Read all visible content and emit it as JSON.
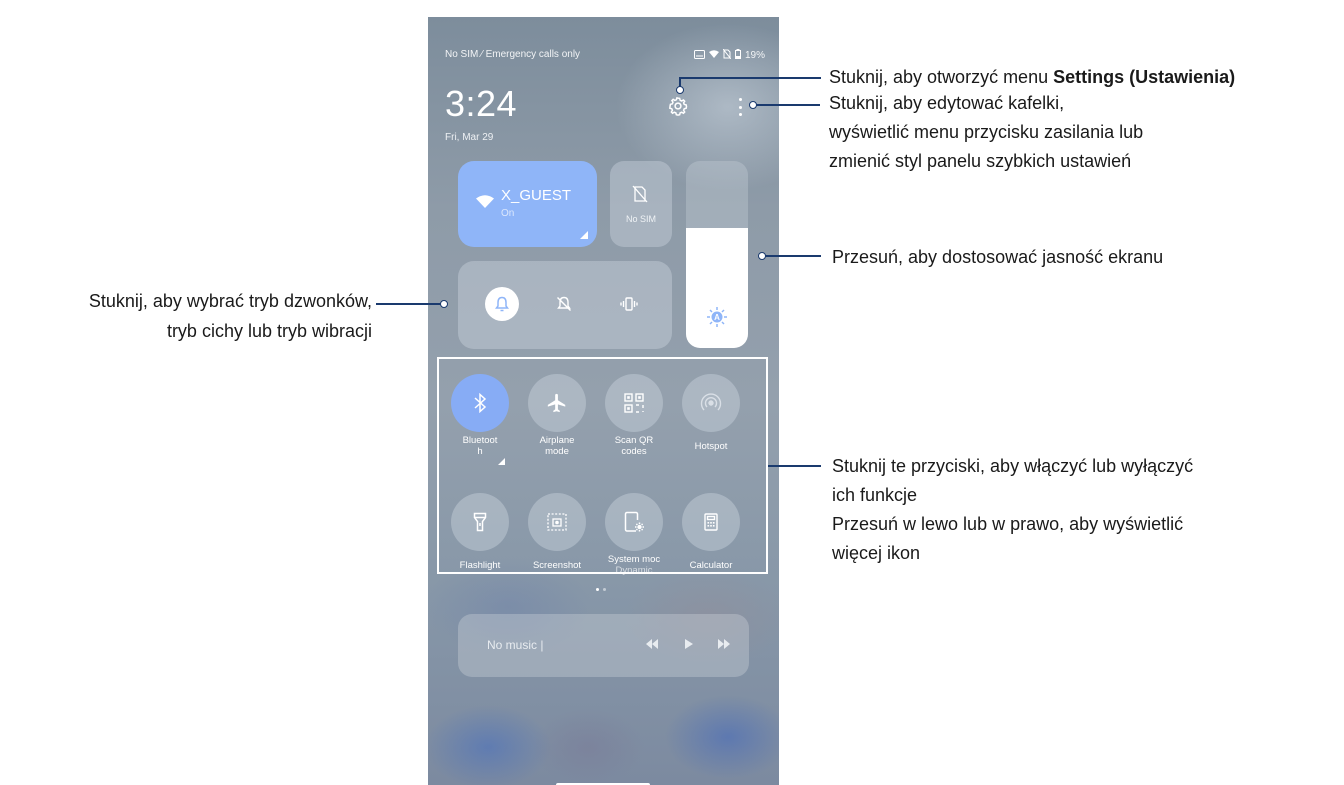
{
  "status_bar": {
    "carrier": "No SIM ⁄ Emergency calls only",
    "battery": "19%"
  },
  "header": {
    "time": "3:24",
    "date": "Fri, Mar 29"
  },
  "tiles": {
    "wifi": {
      "name": "X_GUEST",
      "status": "On"
    },
    "sim": {
      "label": "No SIM"
    },
    "brightness_level": 0.64
  },
  "quick_settings": [
    {
      "label": "Bluetoot\nh",
      "sublabel": "",
      "icon": "bluetooth-icon",
      "on": true
    },
    {
      "label": "Airplane\nmode",
      "sublabel": "",
      "icon": "airplane-icon",
      "on": false
    },
    {
      "label": "Scan QR\ncodes",
      "sublabel": "",
      "icon": "qr-icon",
      "on": false
    },
    {
      "label": "Hotspot",
      "sublabel": "",
      "icon": "hotspot-icon",
      "on": false
    },
    {
      "label": "Flashlight",
      "sublabel": "",
      "icon": "flashlight-icon",
      "on": false
    },
    {
      "label": "Screenshot",
      "sublabel": "",
      "icon": "screenshot-icon",
      "on": false
    },
    {
      "label": "System moc",
      "sublabel": "Dynamic",
      "icon": "system-mode-icon",
      "on": false
    },
    {
      "label": "Calculator",
      "sublabel": "",
      "icon": "calculator-icon",
      "on": false
    }
  ],
  "media": {
    "text": "No music |"
  },
  "annotations": {
    "settings_prefix": "Stuknij, aby otworzyć menu ",
    "settings_bold": "Settings (Ustawienia)",
    "edit_line1": "Stuknij, aby edytować kafelki,",
    "edit_line2": "wyświetlić menu przycisku zasilania lub",
    "edit_line3": "zmienić styl panelu szybkich ustawień",
    "brightness": "Przesuń, aby dostosować jasność ekranu",
    "ring_line1": "Stuknij, aby wybrać tryb dzwonków,",
    "ring_line2": "tryb cichy lub tryb wibracji",
    "toggle_line1": "Stuknij te przyciski, aby włączyć lub wyłączyć",
    "toggle_line2": "ich funkcje",
    "toggle_line3": "Przesuń w lewo lub w prawo, aby wyświetlić",
    "toggle_line4": "więcej ikon"
  },
  "colors": {
    "accent": "#87acf5",
    "annotation_line": "#1a3a6e"
  }
}
